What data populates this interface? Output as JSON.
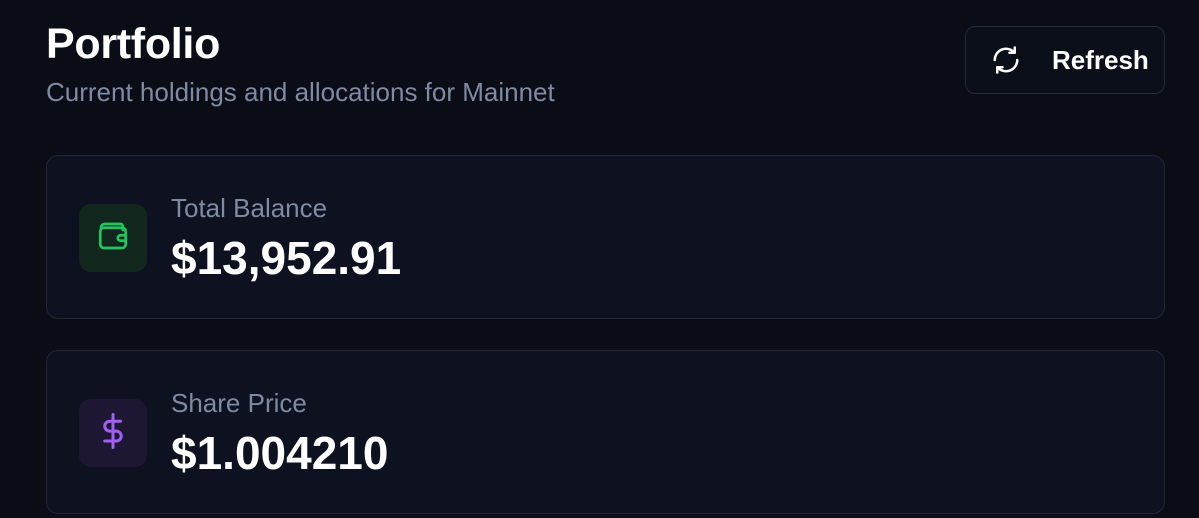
{
  "header": {
    "title": "Portfolio",
    "subtitle": "Current holdings and allocations for Mainnet"
  },
  "actions": {
    "refresh_label": "Refresh",
    "refresh_icon": "refresh-icon"
  },
  "stats": [
    {
      "label": "Total Balance",
      "value": "$13,952.91",
      "icon": "wallet-icon",
      "accent": "#22c55e"
    },
    {
      "label": "Share Price",
      "value": "$1.004210",
      "icon": "dollar-icon",
      "accent": "#a061f0"
    }
  ],
  "colors": {
    "background": "#0a0d16",
    "card": "#0d1120",
    "border": "#1f2637",
    "muted_text": "#7f8aa3"
  }
}
